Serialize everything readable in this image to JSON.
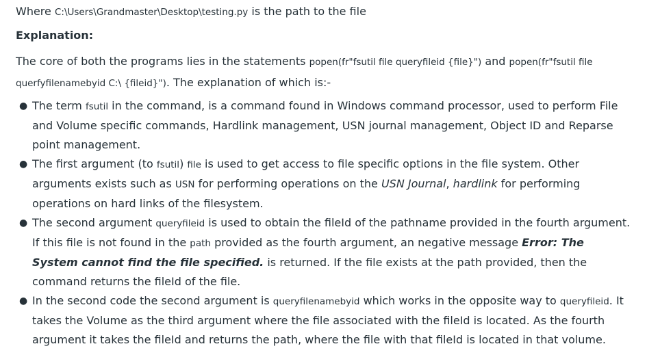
{
  "intro": {
    "prefix": "Where ",
    "path": "C:\\Users\\Grandmaster\\Desktop\\testing.py",
    "suffix": " is the path to the file"
  },
  "heading": "Explanation:",
  "core": {
    "t1": "The core of both the programs lies in the statements ",
    "c1": "popen(fr\"fsutil file queryfileid {file}\")",
    "t2": " and ",
    "c2a": "popen(fr\"fsutil file",
    "c2b": "querfyfilenamebyid C:\\ {fileid}\")",
    "t3": ". The explanation of which is:-"
  },
  "bullets": [
    {
      "t1": "The term ",
      "c1": "fsutil",
      "t2": " in the command, is a command found in Windows command processor, used to perform File and Volume specific commands, Hardlink management, USN journal management, Object ID and Reparse point management."
    },
    {
      "t1": "The first argument (to ",
      "c1": "fsutil",
      "t2": ") ",
      "c2": "file",
      "t3": " is used to get access to file specific options in the file system. Other arguments exists such as ",
      "c3": "USN",
      "t4": " for performing operations on the ",
      "i1": "USN Journal",
      "t5": ", ",
      "i2": "hardlink",
      "t6": " for performing operations on hard links of the filesystem."
    },
    {
      "t1": "The second argument ",
      "c1": "queryfileid",
      "t2": " is used to obtain the fileId of the pathname provided in the fourth argument. If this file is not found in the ",
      "c2": "path",
      "t3": " provided as the fourth argument, an negative message ",
      "b1": "Error: The System cannot find the file specified.",
      "t4": " is returned. If the file exists at the path provided, then the command returns the fileId of the file."
    },
    {
      "t1": "In the second code the second argument is ",
      "c1": "queryfilenamebyid",
      "t2": " which works in the opposite way to ",
      "c2": "queryfileid",
      "t3": ". It takes the Volume as the third argument where the file associated with the fileId is located. As the fourth argument it takes the fileId and returns the path, where the file with that fileId is located in that volume."
    }
  ]
}
